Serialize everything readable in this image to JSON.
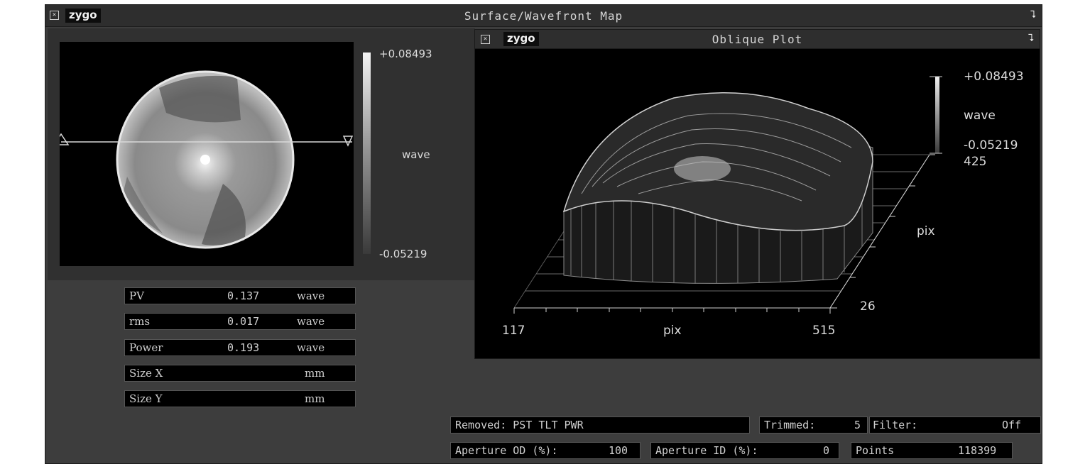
{
  "window": {
    "title": "Surface/Wavefront Map",
    "logo": "zygo"
  },
  "map": {
    "scale_max": "+0.08493",
    "scale_unit": "wave",
    "scale_min": "-0.05219"
  },
  "stats": [
    {
      "name": "PV",
      "value": "0.137",
      "unit": "wave"
    },
    {
      "name": "rms",
      "value": "0.017",
      "unit": "wave"
    },
    {
      "name": "Power",
      "value": "0.193",
      "unit": "wave"
    },
    {
      "name": "Size X",
      "value": "",
      "unit": "mm"
    },
    {
      "name": "Size Y",
      "value": "",
      "unit": "mm"
    }
  ],
  "oblique": {
    "title": "Oblique Plot",
    "logo": "zygo",
    "z_max": "+0.08493",
    "z_unit": "wave",
    "z_min": "-0.05219",
    "y_max": "425",
    "y_label": "pix",
    "y_min": "26",
    "x_min": "117",
    "x_label": "pix",
    "x_max": "515"
  },
  "status": {
    "removed": "Removed: PST TLT PWR",
    "trimmed_label": "Trimmed:",
    "trimmed_value": "5",
    "filter_label": "Filter:",
    "filter_value": "Off",
    "aperture_od_label": "Aperture OD (%):",
    "aperture_od_value": "100",
    "aperture_id_label": "Aperture ID (%):",
    "aperture_id_value": "0",
    "points_label": "Points",
    "points_value": "118399"
  },
  "icons": {
    "close": "close-box-icon",
    "pin": "pin-icon"
  }
}
